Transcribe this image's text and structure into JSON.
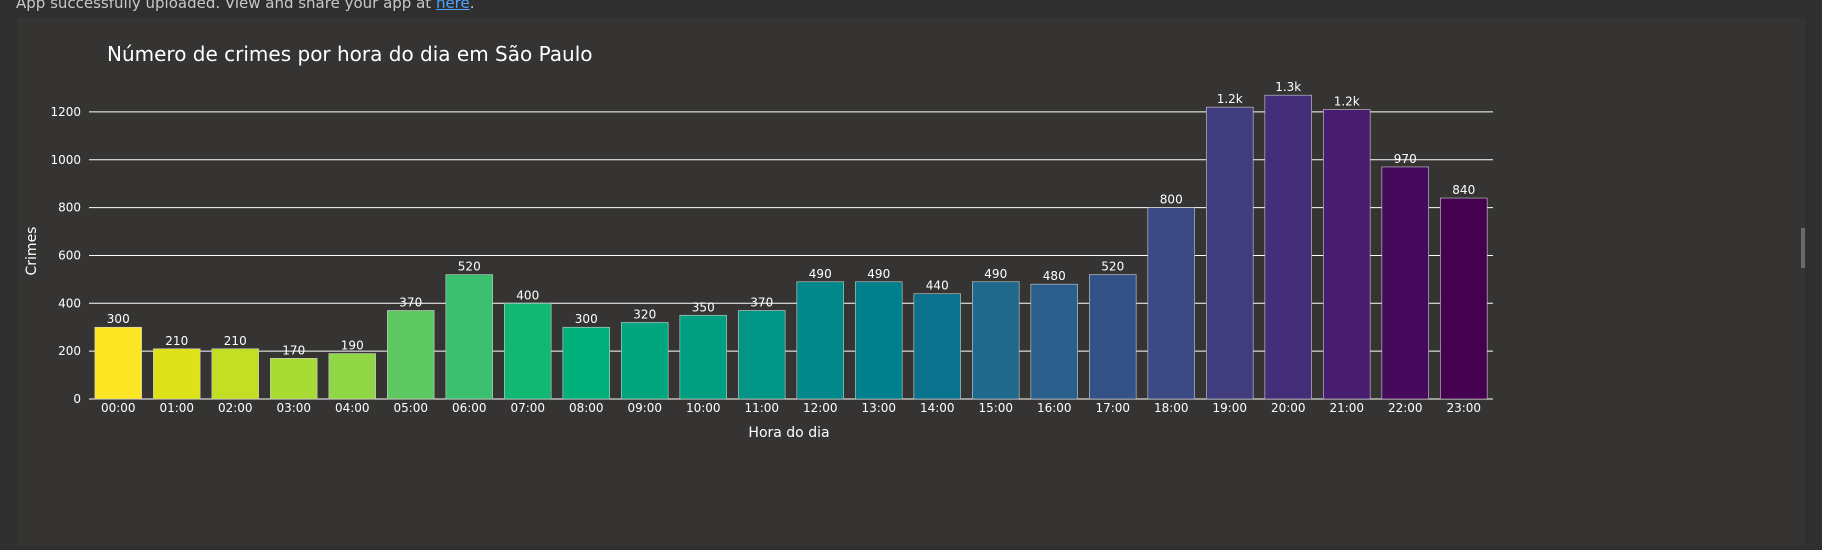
{
  "banner": {
    "message": "App successfully uploaded. View and share your app at ",
    "link_text": "here",
    "link_suffix": "."
  },
  "colors": {
    "page_bg": "#2f2f2f",
    "panel_bg": "#353433",
    "text": "#ffffff",
    "grid": "#ffffff",
    "link": "#4da3ff"
  },
  "chart_data": {
    "type": "bar",
    "title": "Número de crimes por hora do dia em São Paulo",
    "xlabel": "Hora do dia",
    "ylabel": "Crimes",
    "ylim": [
      0,
      1300
    ],
    "yticks": [
      0,
      200,
      400,
      600,
      800,
      1000,
      1200
    ],
    "grid": true,
    "colorscale": "viridis-reversed",
    "categories": [
      "00:00",
      "01:00",
      "02:00",
      "03:00",
      "04:00",
      "05:00",
      "06:00",
      "07:00",
      "08:00",
      "09:00",
      "10:00",
      "11:00",
      "12:00",
      "13:00",
      "14:00",
      "15:00",
      "16:00",
      "17:00",
      "18:00",
      "19:00",
      "20:00",
      "21:00",
      "22:00",
      "23:00"
    ],
    "values": [
      300,
      210,
      210,
      170,
      190,
      370,
      520,
      400,
      300,
      320,
      350,
      370,
      490,
      490,
      440,
      490,
      480,
      520,
      800,
      1220,
      1270,
      1210,
      970,
      840
    ],
    "labels": [
      "300",
      "210",
      "210",
      "170",
      "190",
      "370",
      "520",
      "400",
      "300",
      "320",
      "350",
      "370",
      "490",
      "490",
      "440",
      "490",
      "480",
      "520",
      "800",
      "1.2k",
      "1.3k",
      "1.2k",
      "970",
      "840"
    ],
    "bar_colors": [
      "#fde725",
      "#dde318",
      "#c2df23",
      "#a8db34",
      "#8fd744",
      "#5ec962",
      "#3bc06f",
      "#10b874",
      "#00b07a",
      "#00a77e",
      "#009e81",
      "#009584",
      "#00888a",
      "#007f8d",
      "#0b728e",
      "#1f698d",
      "#2a5f8b",
      "#335388",
      "#3b4a84",
      "#403c7e",
      "#452e79",
      "#481d6f",
      "#460a5d",
      "#44014f"
    ]
  }
}
